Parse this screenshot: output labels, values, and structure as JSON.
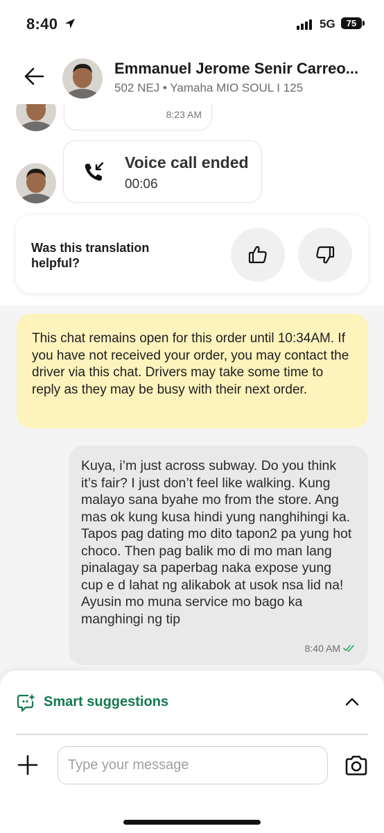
{
  "status_bar": {
    "time": "8:40",
    "network": "5G",
    "battery": "75"
  },
  "header": {
    "driver_name": "Emmanuel Jerome Senir Carreo...",
    "vehicle_info": "502 NEJ • Yamaha MIO SOUL I 125"
  },
  "messages": {
    "partial_timestamp": "8:23 AM",
    "call": {
      "title": "Voice call ended",
      "duration": "00:06"
    },
    "feedback_question": "Was this translation helpful?",
    "notice": "This chat remains open for this order until 10:34AM. If you have not received your order, you may contact the driver via this chat. Drivers may take some time to reply as they may be busy with their next order.",
    "user_message": {
      "text": "Kuya, i’m just across subway. Do you think it’s fair? I just don’t feel like walking. Kung malayo sana byahe mo from the store. Ang mas ok kung kusa hindi yung nanghihingi ka. Tapos pag dating mo dito tapon2 pa yung hot choco. Then pag balik mo di mo man lang pinalagay sa paperbag naka expose yung cup e d lahat ng alikabok at usok nsa lid na! Ayusin mo muna service mo bago ka manghingi ng tip",
      "time": "8:40 AM",
      "status": "read"
    }
  },
  "composer": {
    "smart_suggestions_label": "Smart suggestions",
    "input_placeholder": "Type your message",
    "input_value": ""
  },
  "icons": {
    "back": "back-arrow-icon",
    "call": "call-ended-icon",
    "thumbs_up": "thumbs-up-icon",
    "thumbs_down": "thumbs-down-icon",
    "sparkle": "smart-suggestion-icon",
    "collapse": "chevron-up-icon",
    "add": "plus-icon",
    "camera": "camera-icon"
  },
  "colors": {
    "accent_green": "#127a4e",
    "notice_background": "#fdf3bd",
    "user_bubble": "#e9e9e9",
    "read_check": "#2eaa6a"
  }
}
